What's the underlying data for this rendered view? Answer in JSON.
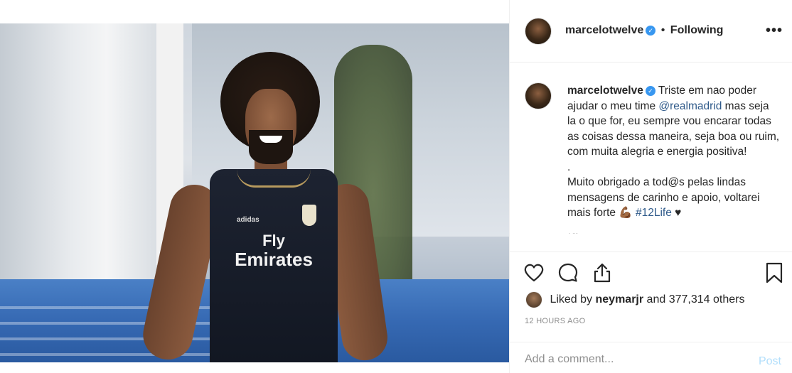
{
  "header": {
    "username": "marcelotwelve",
    "separator": "•",
    "follow_state": "Following",
    "more_label": "•••"
  },
  "caption": {
    "username": "marcelotwelve",
    "text_1": "Triste em nao poder ajudar o meu time",
    "mention": "@realmadrid",
    "text_2": "mas seja la o que for, eu sempre vou encarar todas as coisas dessa maneira, seja boa ou ruim, com muita alegria e energia positiva!",
    "dot": ".",
    "text_3": "Muito obrigado a tod@s pelas lindas mensagens de carinho e apoio, voltarei mais forte",
    "emoji_flex": "💪🏾",
    "hashtag": "#12Life",
    "emoji_heart": "♥",
    "time_cut": "12h"
  },
  "photo": {
    "sponsor_line1": "Fly",
    "sponsor_line2": "Emirates",
    "kit_maker": "adidas"
  },
  "likes": {
    "prefix": "Liked by",
    "user": "neymarjr",
    "suffix": "and 377,314 others"
  },
  "timestamp": "12 HOURS AGO",
  "comment": {
    "placeholder": "Add a comment...",
    "post_label": "Post"
  },
  "colors": {
    "verified": "#3897f0",
    "link": "#2f5a8a",
    "post_disabled": "#b2dffc",
    "muted": "#8e8e8e"
  },
  "icons": [
    "heart-icon",
    "comment-icon",
    "share-icon",
    "bookmark-icon",
    "verified-icon",
    "more-icon"
  ]
}
